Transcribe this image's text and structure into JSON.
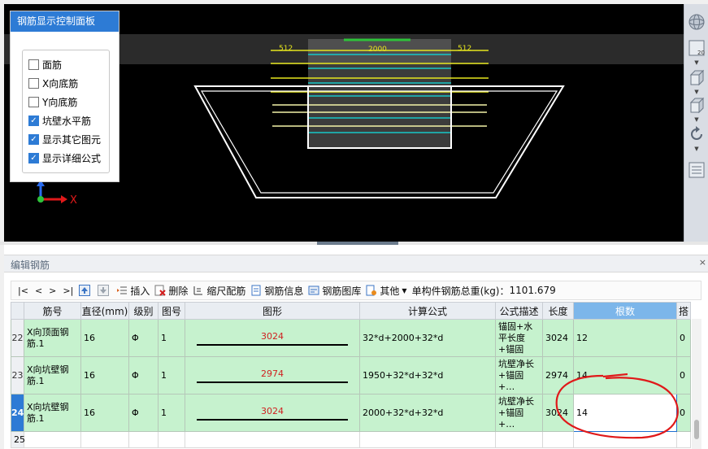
{
  "panel": {
    "title": "钢筋显示控制面板",
    "items": [
      {
        "label": "面筋",
        "checked": false
      },
      {
        "label": "X向底筋",
        "checked": false
      },
      {
        "label": "Y向底筋",
        "checked": false
      },
      {
        "label": "坑壁水平筋",
        "checked": true
      },
      {
        "label": "显示其它图元",
        "checked": true
      },
      {
        "label": "显示详细公式",
        "checked": true
      }
    ]
  },
  "viewport": {
    "dim_left": "512",
    "dim_center": "2000",
    "dim_right": "512",
    "axis_x_label": "X",
    "zoom_label": "20"
  },
  "editpane": {
    "title": "编辑钢筋",
    "close_label": "×"
  },
  "toolbar": {
    "nav_first": "|<",
    "nav_prev": "<",
    "nav_next": ">",
    "nav_last": ">|",
    "insert": "插入",
    "delete": "删除",
    "scale": "缩尺配筋",
    "info": "钢筋信息",
    "library": "钢筋图库",
    "other": "其他",
    "total_label": "单构件钢筋总重(kg)：",
    "total_value": "1101.679"
  },
  "table": {
    "headers": [
      "筋号",
      "直径(mm)",
      "级别",
      "图号",
      "图形",
      "计算公式",
      "公式描述",
      "长度",
      "根数",
      "搭"
    ],
    "rows": [
      {
        "idx": "22",
        "name": "X向顶面钢筋.1",
        "dia": "16",
        "grade": "Φ",
        "fig": "1",
        "shape": "3024",
        "formula": "32*d+2000+32*d",
        "desc": "锚固+水平长度+锚固",
        "len": "3024",
        "count": "12",
        "lap": "0"
      },
      {
        "idx": "23",
        "name": "X向坑壁钢筋.1",
        "dia": "16",
        "grade": "Φ",
        "fig": "1",
        "shape": "2974",
        "formula": "1950+32*d+32*d",
        "desc": "坑壁净长+锚固+…",
        "len": "2974",
        "count": "14",
        "lap": "0"
      },
      {
        "idx": "24",
        "name": "X向坑壁钢筋.1",
        "dia": "16",
        "grade": "Φ",
        "fig": "1",
        "shape": "3024",
        "formula": "2000+32*d+32*d",
        "desc": "坑壁净长+锚固+…",
        "len": "3024",
        "count": "14",
        "lap": "0"
      },
      {
        "idx": "25"
      }
    ]
  },
  "colors": {
    "accent": "#2d7bd5",
    "row_green": "#c6f2ce",
    "annotation_red": "#e0191a",
    "rebar_yellow": "#e6e61e",
    "rebar_cyan": "#17c7c7"
  }
}
